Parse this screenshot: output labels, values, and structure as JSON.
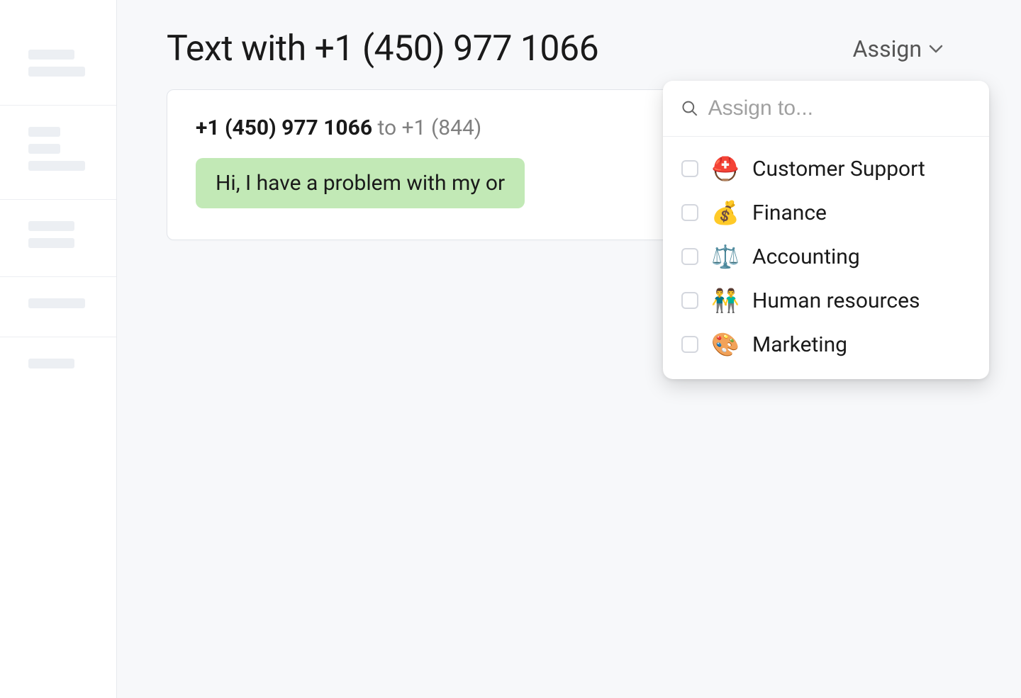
{
  "header": {
    "title": "Text with +1 (450) 977 1066",
    "assign_label": "Assign"
  },
  "card": {
    "from": "+1 (450) 977 1066",
    "to_word": "to",
    "to_number": "+1 (844)",
    "message": "Hi, I have a problem with my or"
  },
  "dropdown": {
    "search_placeholder": "Assign to...",
    "options": [
      {
        "emoji": "⛑️",
        "label": "Customer Support"
      },
      {
        "emoji": "💰",
        "label": "Finance"
      },
      {
        "emoji": "⚖️",
        "label": "Accounting"
      },
      {
        "emoji": "👬",
        "label": "Human resources"
      },
      {
        "emoji": "🎨",
        "label": "Marketing"
      }
    ]
  }
}
